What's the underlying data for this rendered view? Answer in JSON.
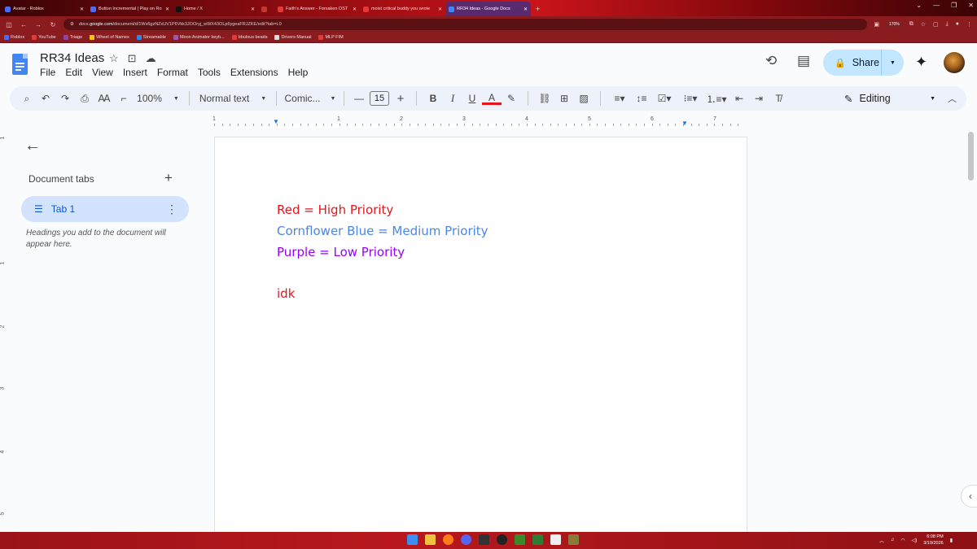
{
  "browser": {
    "tabs": [
      {
        "title": "Avatar - Roblox",
        "color": "#4a6cf7",
        "active": false
      },
      {
        "title": "Button Incremental | Play on Ro",
        "color": "#4a6cf7",
        "active": false
      },
      {
        "title": "Home / X",
        "color": "#111111",
        "active": false
      },
      {
        "title": "",
        "color": "#c0392b",
        "active": false
      },
      {
        "title": "Faith's Answer - Forsaken OST",
        "color": "#e53935",
        "active": false
      },
      {
        "title": "moist critical buddy you wrote",
        "color": "#e53935",
        "active": false
      },
      {
        "title": "RR34 Ideas - Google Docs",
        "color": "#4285f4",
        "active": true
      }
    ],
    "url_prefix": "docs.",
    "url_domain": "google.com",
    "url_rest": "/document/d/1Wx6gzNZxUV1P6Vkk3JOOryj_wWX43OLp6ygeaFRJZKE/edit?tab=t.0",
    "zoom": "170%",
    "bookmarks": [
      {
        "label": "Roblox",
        "color": "#4a6cf7"
      },
      {
        "label": "YouTube",
        "color": "#e53935"
      },
      {
        "label": "Triage",
        "color": "#8e44ad"
      },
      {
        "label": "Wheel of Names",
        "color": "#f1c40f"
      },
      {
        "label": "Streamable",
        "color": "#2e86de"
      },
      {
        "label": "Moon Animator keyb...",
        "color": "#9b59b6"
      },
      {
        "label": "bbulous beads",
        "color": "#e53935"
      },
      {
        "label": "Drivers Manual",
        "color": "#dddddd"
      },
      {
        "label": "MLP FIM",
        "color": "#e53935"
      }
    ]
  },
  "doc": {
    "title": "RR34 Ideas",
    "menu": [
      "File",
      "Edit",
      "View",
      "Insert",
      "Format",
      "Tools",
      "Extensions",
      "Help"
    ],
    "share_label": "Share",
    "toolbar": {
      "zoom": "100%",
      "style": "Normal text",
      "font": "Comic...",
      "font_size": "15",
      "mode": "Editing"
    },
    "ruler_numbers": [
      "1",
      "1",
      "2",
      "3",
      "4",
      "5",
      "6",
      "7"
    ],
    "vruler_numbers": [
      "1",
      "1",
      "2",
      "3",
      "4",
      "5"
    ],
    "sidebar": {
      "section_title": "Document tabs",
      "tab_label": "Tab 1",
      "hint": "Headings you add to the document will appear here."
    },
    "body_lines": [
      {
        "text": "Red = High Priority",
        "color": "#e8141b"
      },
      {
        "text": "Cornflower Blue = Medium Priority",
        "color": "#4a86e8"
      },
      {
        "text": "Purple = Low Priority",
        "color": "#9900ff"
      },
      {
        "text": "idk",
        "color": "#e8141b"
      }
    ]
  },
  "taskbar": {
    "time": "6:08 PM",
    "date": "3/19/2026"
  }
}
